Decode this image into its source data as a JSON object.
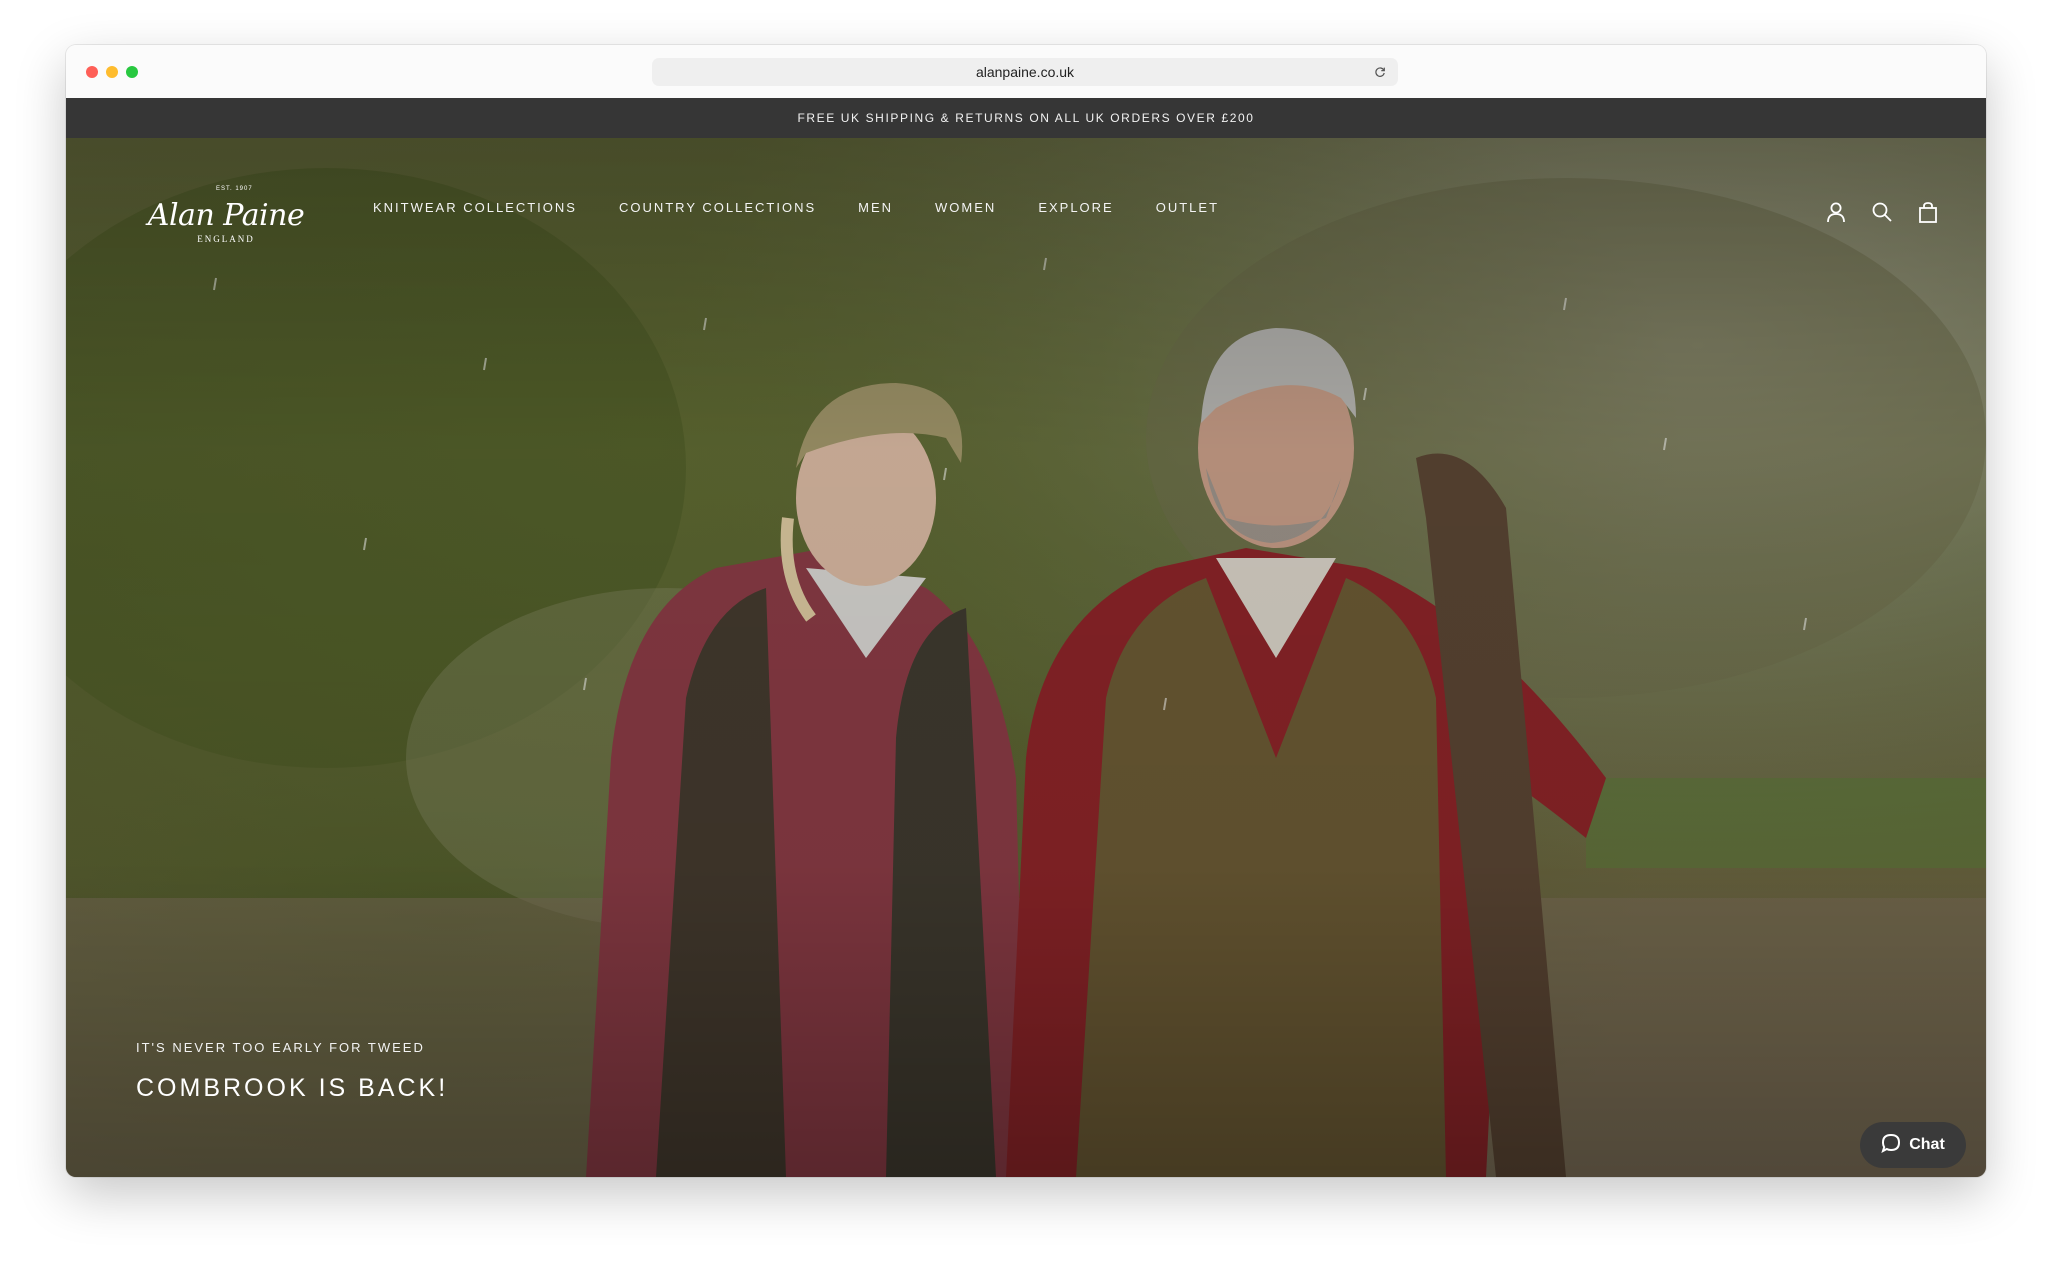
{
  "browser": {
    "url": "alanpaine.co.uk",
    "reload_icon": "reload-icon"
  },
  "announcement": {
    "text": "FREE UK SHIPPING & RETURNS ON ALL UK ORDERS OVER £200"
  },
  "logo": {
    "est": "EST. 1907",
    "word": "Alan Paine",
    "country": "ENGLAND"
  },
  "nav": {
    "items": [
      {
        "label": "KNITWEAR COLLECTIONS"
      },
      {
        "label": "COUNTRY COLLECTIONS"
      },
      {
        "label": "MEN"
      },
      {
        "label": "WOMEN"
      },
      {
        "label": "EXPLORE"
      },
      {
        "label": "OUTLET"
      }
    ]
  },
  "header_icons": [
    "account-icon",
    "search-icon",
    "bag-icon"
  ],
  "hero": {
    "kicker": "IT'S NEVER TOO EARLY FOR TWEED",
    "headline": "COMBROOK IS BACK!"
  },
  "chat": {
    "label": "Chat",
    "icon": "chat-bubble-icon"
  },
  "colors": {
    "announcement_bg": "#363636",
    "chat_bg": "#3a3a3a",
    "hero_tint": "#5a6230"
  }
}
